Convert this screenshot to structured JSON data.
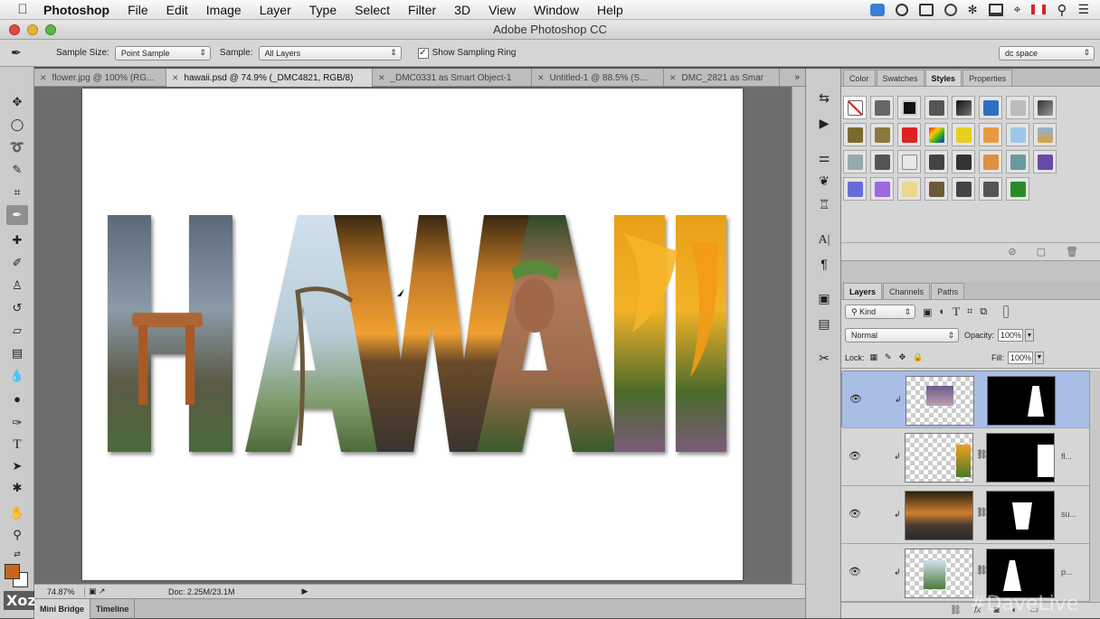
{
  "menubar": {
    "app": "Photoshop",
    "items": [
      "File",
      "Edit",
      "Image",
      "Layer",
      "Type",
      "Select",
      "Filter",
      "3D",
      "View",
      "Window",
      "Help"
    ]
  },
  "window": {
    "title": "Adobe Photoshop CC"
  },
  "options": {
    "sample_size_label": "Sample Size:",
    "sample_size_value": "Point Sample",
    "sample_label": "Sample:",
    "sample_value": "All Layers",
    "show_ring_label": "Show Sampling Ring",
    "workspace_value": "dc space"
  },
  "doc_tabs": [
    {
      "label": "flower.jpg @ 100% (RG...",
      "active": false
    },
    {
      "label": "hawaii.psd @ 74.9% (_DMC4821, RGB/8)",
      "active": true
    },
    {
      "label": "_DMC0331 as Smart Object-1",
      "active": false
    },
    {
      "label": "Untitled-1 @ 88.5% (S...",
      "active": false
    },
    {
      "label": "DMC_2821 as Smar",
      "active": false
    }
  ],
  "artwork": {
    "text": "HAWAII"
  },
  "status": {
    "zoom": "74.87%",
    "doc": "Doc: 2.25M/23.1M"
  },
  "bottom_tabs": [
    "Mini Bridge",
    "Timeline"
  ],
  "styles_panel": {
    "tabs": [
      "Color",
      "Swatches",
      "Styles",
      "Properties"
    ],
    "active": "Styles"
  },
  "layers_panel": {
    "tabs": [
      "Layers",
      "Channels",
      "Paths"
    ],
    "active": "Layers",
    "filter_value": "Kind",
    "blend_mode": "Normal",
    "opacity_label": "Opacity:",
    "opacity_value": "100%",
    "lock_label": "Lock:",
    "fill_label": "Fill:",
    "fill_value": "100%",
    "layers": [
      {
        "name": "",
        "selected": true
      },
      {
        "name": "fl...",
        "selected": false
      },
      {
        "name": "su...",
        "selected": false
      },
      {
        "name": "p...",
        "selected": false
      }
    ]
  },
  "watermarks": {
    "left": "Xoz",
    "right": "#DaveLive"
  },
  "colors": {
    "foreground": "#c8661e",
    "background": "#ffffff",
    "selection": "#a9bde6"
  }
}
